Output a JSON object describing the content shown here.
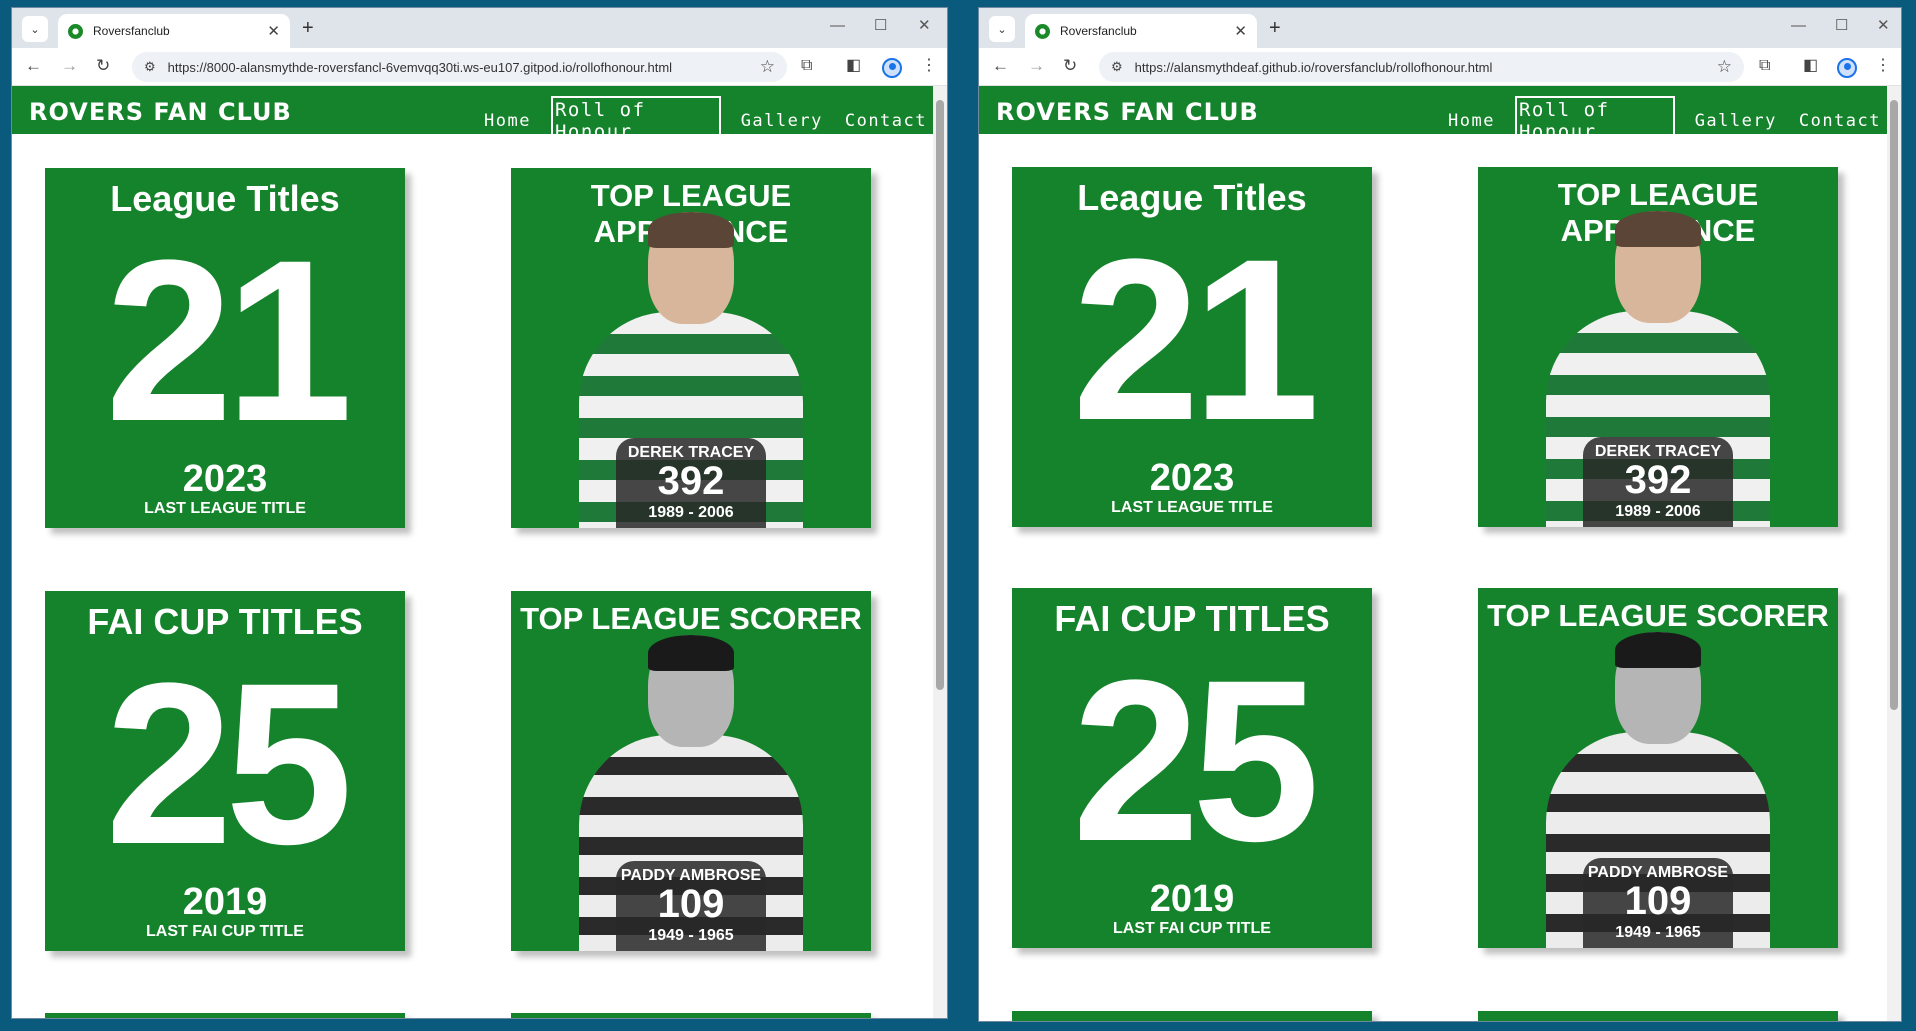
{
  "windows": [
    {
      "tab": {
        "title": "Roversfanclub",
        "close": "✕",
        "new": "+"
      },
      "url": "https://8000-alansmythde-roversfancl-6vemvqq30ti.ws-eu107.gitpod.io/rollofhonour.html"
    },
    {
      "tab": {
        "title": "Roversfanclub",
        "close": "✕",
        "new": "+"
      },
      "url": "https://alansmythdeaf.github.io/roversfanclub/rollofhonour.html"
    }
  ],
  "site": {
    "brand": "ROVERS FAN CLUB",
    "nav": [
      "Home",
      "Roll of Honour",
      "Gallery",
      "Contact"
    ],
    "active_nav": "Roll of Honour",
    "accent": "#15832b"
  },
  "cards": {
    "league": {
      "title": "League Titles",
      "number": "21",
      "year": "2023",
      "caption": "LAST LEAGUE TITLE"
    },
    "appearance": {
      "title": "TOP LEAGUE APPERANCE",
      "player": "DEREK TRACEY",
      "number": "392",
      "years": "1989 - 2006"
    },
    "cup": {
      "title": "FAI CUP TITLES",
      "number": "25",
      "year": "2019",
      "caption": "LAST  FAI CUP TITLE"
    },
    "scorer": {
      "title": "TOP LEAGUE SCORER",
      "player": "PADDY AMBROSE",
      "number": "109",
      "years": "1949 - 1965"
    }
  }
}
